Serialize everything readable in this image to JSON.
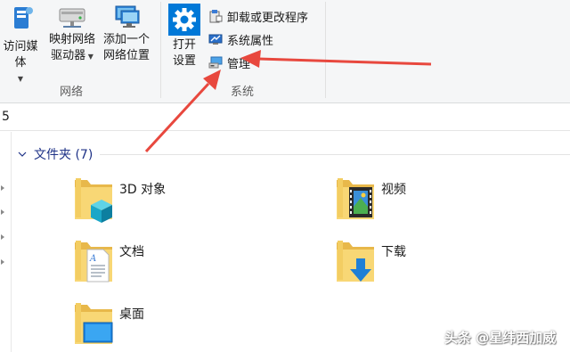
{
  "ribbon": {
    "network_group": {
      "label": "网络",
      "access_media": "访问媒体",
      "map_drive_line1": "映射网络",
      "map_drive_line2": "驱动器",
      "add_location_line1": "添加一个",
      "add_location_line2": "网络位置"
    },
    "system_group": {
      "label": "系统",
      "settings_line1": "打开",
      "settings_line2": "设置",
      "uninstall": "卸载或更改程序",
      "system_properties": "系统属性",
      "manage": "管理"
    }
  },
  "address": {
    "value": "5"
  },
  "content": {
    "section_title": "文件夹 (7)",
    "folders": [
      {
        "label": "3D 对象",
        "icon": "3d-objects-folder-icon"
      },
      {
        "label": "视频",
        "icon": "videos-folder-icon"
      },
      {
        "label": "文档",
        "icon": "documents-folder-icon"
      },
      {
        "label": "下载",
        "icon": "downloads-folder-icon"
      },
      {
        "label": "桌面",
        "icon": "desktop-folder-icon"
      }
    ]
  },
  "annotations": {
    "arrow_color": "#e8483e"
  },
  "watermark": {
    "text": "头条 @星纬西加威"
  },
  "colors": {
    "folder_yellow": "#f8d775",
    "section_blue": "#1e3287",
    "gear_blue": "#0078d7"
  }
}
